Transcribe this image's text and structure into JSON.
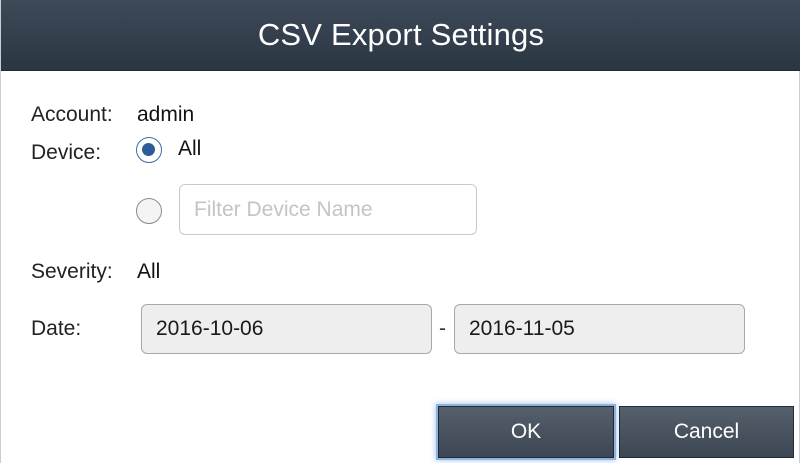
{
  "dialog": {
    "title": "CSV Export Settings"
  },
  "account": {
    "label": "Account:",
    "value": "admin"
  },
  "device": {
    "label": "Device:",
    "option_all_label": "All",
    "selected": "All",
    "filter_placeholder": "Filter Device Name"
  },
  "severity": {
    "label": "Severity:",
    "value": "All"
  },
  "date": {
    "label": "Date:",
    "from": "2016-10-06",
    "separator": "-",
    "to": "2016-11-05"
  },
  "buttons": {
    "ok_label": "OK",
    "cancel_label": "Cancel"
  },
  "colors": {
    "titlebar": "#2b3643",
    "button": "#3c4654",
    "radio_selected": "#2b5d98"
  }
}
